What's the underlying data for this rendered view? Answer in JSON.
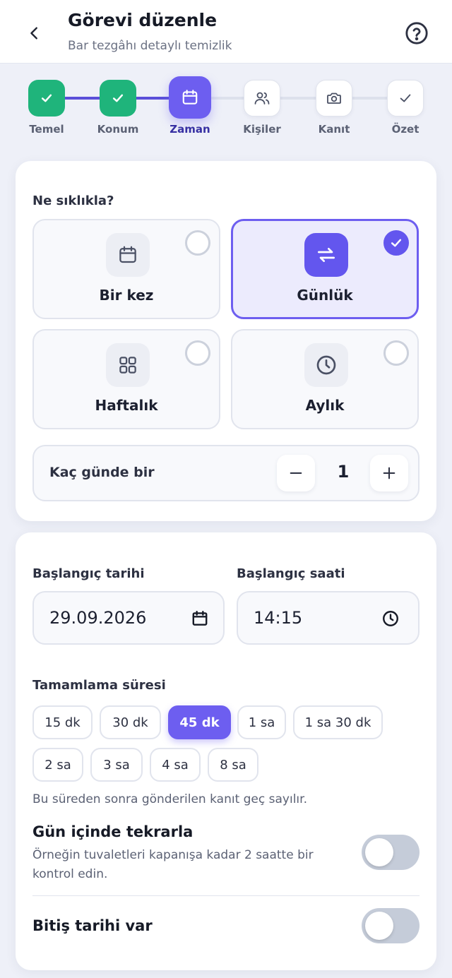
{
  "header": {
    "title": "Görevi düzenle",
    "subtitle": "Bar tezgâhı detaylı temizlik"
  },
  "stepper": {
    "steps": [
      {
        "label": "Temel",
        "state": "done"
      },
      {
        "label": "Konum",
        "state": "done"
      },
      {
        "label": "Zaman",
        "state": "active"
      },
      {
        "label": "Kişiler",
        "state": "pending"
      },
      {
        "label": "Kanıt",
        "state": "pending"
      },
      {
        "label": "Özet",
        "state": "pending"
      }
    ]
  },
  "frequency": {
    "label": "Ne sıklıkla?",
    "options": [
      {
        "label": "Bir kez",
        "icon": "calendar-icon",
        "selected": false
      },
      {
        "label": "Günlük",
        "icon": "repeat-icon",
        "selected": true
      },
      {
        "label": "Haftalık",
        "icon": "grid-icon",
        "selected": false
      },
      {
        "label": "Aylık",
        "icon": "clock-icon",
        "selected": false
      }
    ],
    "interval_label": "Kaç günde bir",
    "interval_value": "1"
  },
  "schedule": {
    "start_date_label": "Başlangıç tarihi",
    "start_date_value": "29.09.2026",
    "start_time_label": "Başlangıç saati",
    "start_time_value": "14:15"
  },
  "duration": {
    "label": "Tamamlama süresi",
    "chips": [
      "15 dk",
      "30 dk",
      "45 dk",
      "1 sa",
      "1 sa 30 dk",
      "2 sa",
      "3 sa",
      "4 sa",
      "8 sa"
    ],
    "selected": "45 dk",
    "hint": "Bu süreden sonra gönderilen kanıt geç sayılır."
  },
  "repeat_in_day": {
    "title": "Gün içinde tekrarla",
    "description": "Örneğin tuvaletleri kapanışa kadar 2 saatte bir kontrol edin.",
    "enabled": false
  },
  "end_date": {
    "title": "Bitiş tarihi var",
    "enabled": false
  },
  "colors": {
    "accent": "#6d5ef0",
    "done": "#1fb47b",
    "toggle_off": "#c5ccd9"
  }
}
